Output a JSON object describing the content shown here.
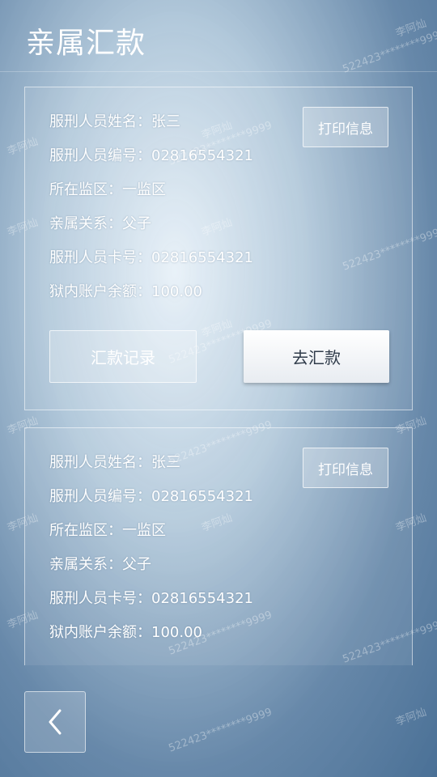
{
  "page": {
    "title": "亲属汇款"
  },
  "cards": [
    {
      "name_row": "服刑人员姓名：张三",
      "id_row": "服刑人员编号：02816554321",
      "area_row": "所在监区：一监区",
      "relation_row": "亲属关系：父子",
      "card_row": "服刑人员卡号：02816554321",
      "balance_row": "狱内账户余额：100.00",
      "print_label": "打印信息",
      "record_label": "汇款记录",
      "remit_label": "去汇款"
    },
    {
      "name_row": "服刑人员姓名：张三",
      "id_row": "服刑人员编号：02816554321",
      "area_row": "所在监区：一监区",
      "relation_row": "亲属关系：父子",
      "card_row": "服刑人员卡号：02816554321",
      "balance_row": "狱内账户余额：100.00",
      "print_label": "打印信息"
    }
  ],
  "watermark": {
    "name": "李阿灿",
    "number": "522423********9999"
  },
  "icons": {
    "back": "chevron-left-icon"
  }
}
